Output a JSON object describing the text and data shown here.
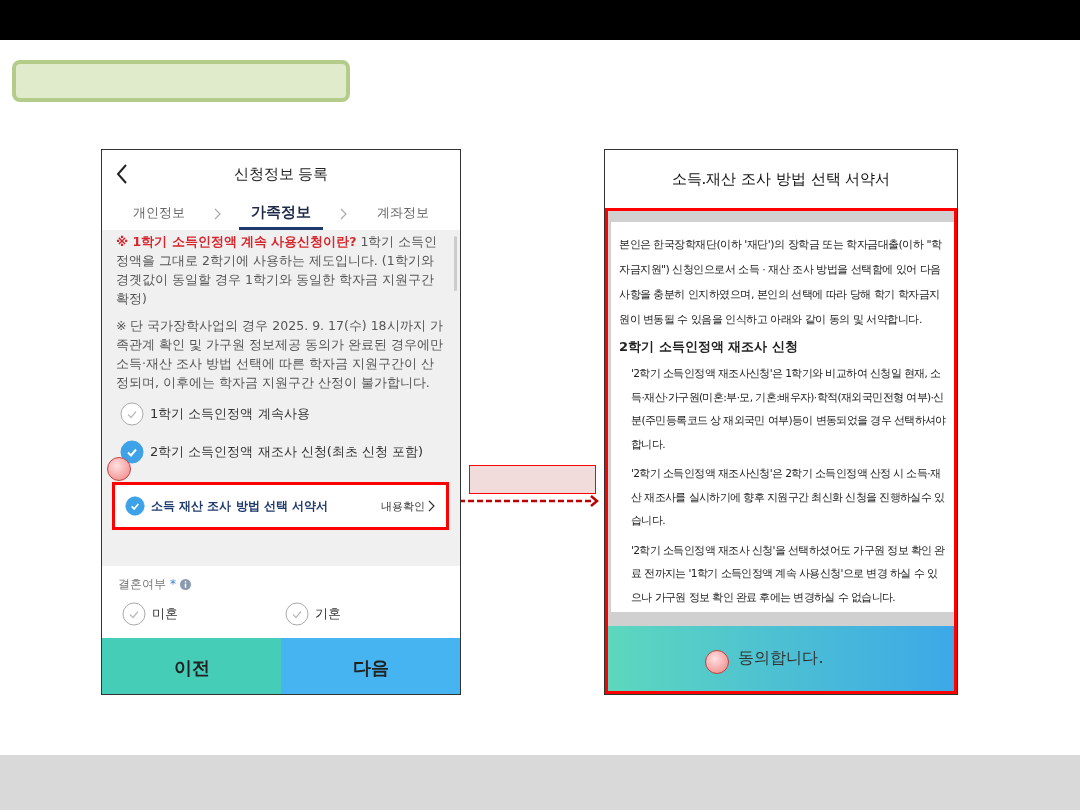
{
  "left_screen": {
    "title": "신청정보 등록",
    "tabs": [
      {
        "label": "개인정보",
        "selected": false
      },
      {
        "label": "가족정보",
        "selected": true
      },
      {
        "label": "계좌정보",
        "selected": false
      }
    ],
    "notices": [
      "**※ 1학기 소득인정액 계속 사용신청이란?** 1학기 소득인정액을 그대로 2학기에 사용하는 제도입니다. (1학기와 경곗값이 동일할 경우 1학기와 동일한 학자금 지원구간 확정)",
      "※ 단 국가장학사업의 경우 2025. 9. 17(수) 18시까지 가족관계 확인 및 가구원 정보제공 동의가 완료된 경우에만 소득·재산 조사 방법 선택에 따른 학자금 지원구간이 산정되며, 이후에는 학자금 지원구간 산정이 불가합니다."
    ],
    "options": [
      {
        "label": "1학기 소득인정액 계속사용",
        "checked": false
      },
      {
        "label": "2학기 소득인정액 재조사 신청(최초 신청 포함)",
        "checked": true
      }
    ],
    "agreement": {
      "label": "소득 재산 조사 방법 선택 서약서",
      "checked": true,
      "link": "내용확인"
    },
    "marital": {
      "label": "결혼여부",
      "required_mark": "*",
      "options": [
        {
          "label": "미혼",
          "checked": false
        },
        {
          "label": "기혼",
          "checked": false
        }
      ]
    },
    "buttons": [
      {
        "label": "이전",
        "kind": "prev"
      },
      {
        "label": "다음",
        "kind": "next"
      }
    ]
  },
  "right_screen": {
    "title": "소득.재산 조사 방법 선택 서약서",
    "intro": "본인은 한국장학재단(이하 '재단')의 장학금 또는 학자금대출(이하 \"학자금지원\") 신청인으로서 소득 · 재산 조사 방법을 선택함에 있어 다음 사항을 충분히 인지하였으며, 본인의 선택에 따라 당해 학기 학자금지원이 변동될 수 있음을 인식하고 아래와 같이 동의 및 서약합니다.",
    "section_heading": "2학기 소득인정액 재조사 신청",
    "items": [
      "'2학기 소득인정액 재조사신청'은 1학기와 비교하여 신청일 현재, 소득·재산·가구원(미혼:부·모, 기혼:배우자)·학적(재외국민전형 여부)·신분(주민등록코드 상 재외국민 여부)등이 변동되었을 경우 선택하셔야 합니다.",
      "'2학기 소득인정액 재조사신청'은 2학기 소득인정액 산정 시 소득·재산 재조사를 실시하기에 향후 지원구간 최신화 신청을 진행하실수 있습니다.",
      "'2학기 소득인정액 재조사 신청'을 선택하셨어도 가구원 정보 확인 완료 전까지는 '1학기 소득인정액 계속 사용신청'으로 변경 하실 수 있으나 가구원 정보 확인 완료 후에는 변경하실 수 없습니다."
    ],
    "agree_button": "동의합니다."
  }
}
